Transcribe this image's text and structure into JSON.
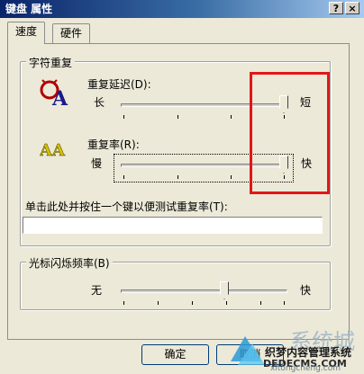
{
  "window": {
    "title": "键盘 属性",
    "help_glyph": "?",
    "close_glyph": "×"
  },
  "tabs": [
    {
      "label": "速度",
      "active": true
    },
    {
      "label": "硬件",
      "active": false
    }
  ],
  "repeat_group": {
    "legend": "字符重复",
    "delay": {
      "label": "重复延迟(D):",
      "left": "长",
      "right": "短",
      "level": 1.0
    },
    "rate": {
      "label": "重复率(R):",
      "left": "慢",
      "right": "快",
      "level": 1.0
    },
    "test": {
      "label": "单击此处并按住一个键以便测试重复率(T):",
      "value": ""
    }
  },
  "blink_group": {
    "legend": "光标闪烁频率(B)",
    "left": "无",
    "right": "快",
    "level": 0.7
  },
  "buttons": {
    "ok": "确定",
    "cancel": "取消"
  },
  "watermark": {
    "brand": "织梦内容管理系统",
    "url": "DEDECMS.COM",
    "site": "xitongcheng.com",
    "logo_text": "系统城"
  },
  "colors": {
    "title_bar": "#0a246a",
    "highlight": "#e01818",
    "face": "#ece9d8"
  }
}
